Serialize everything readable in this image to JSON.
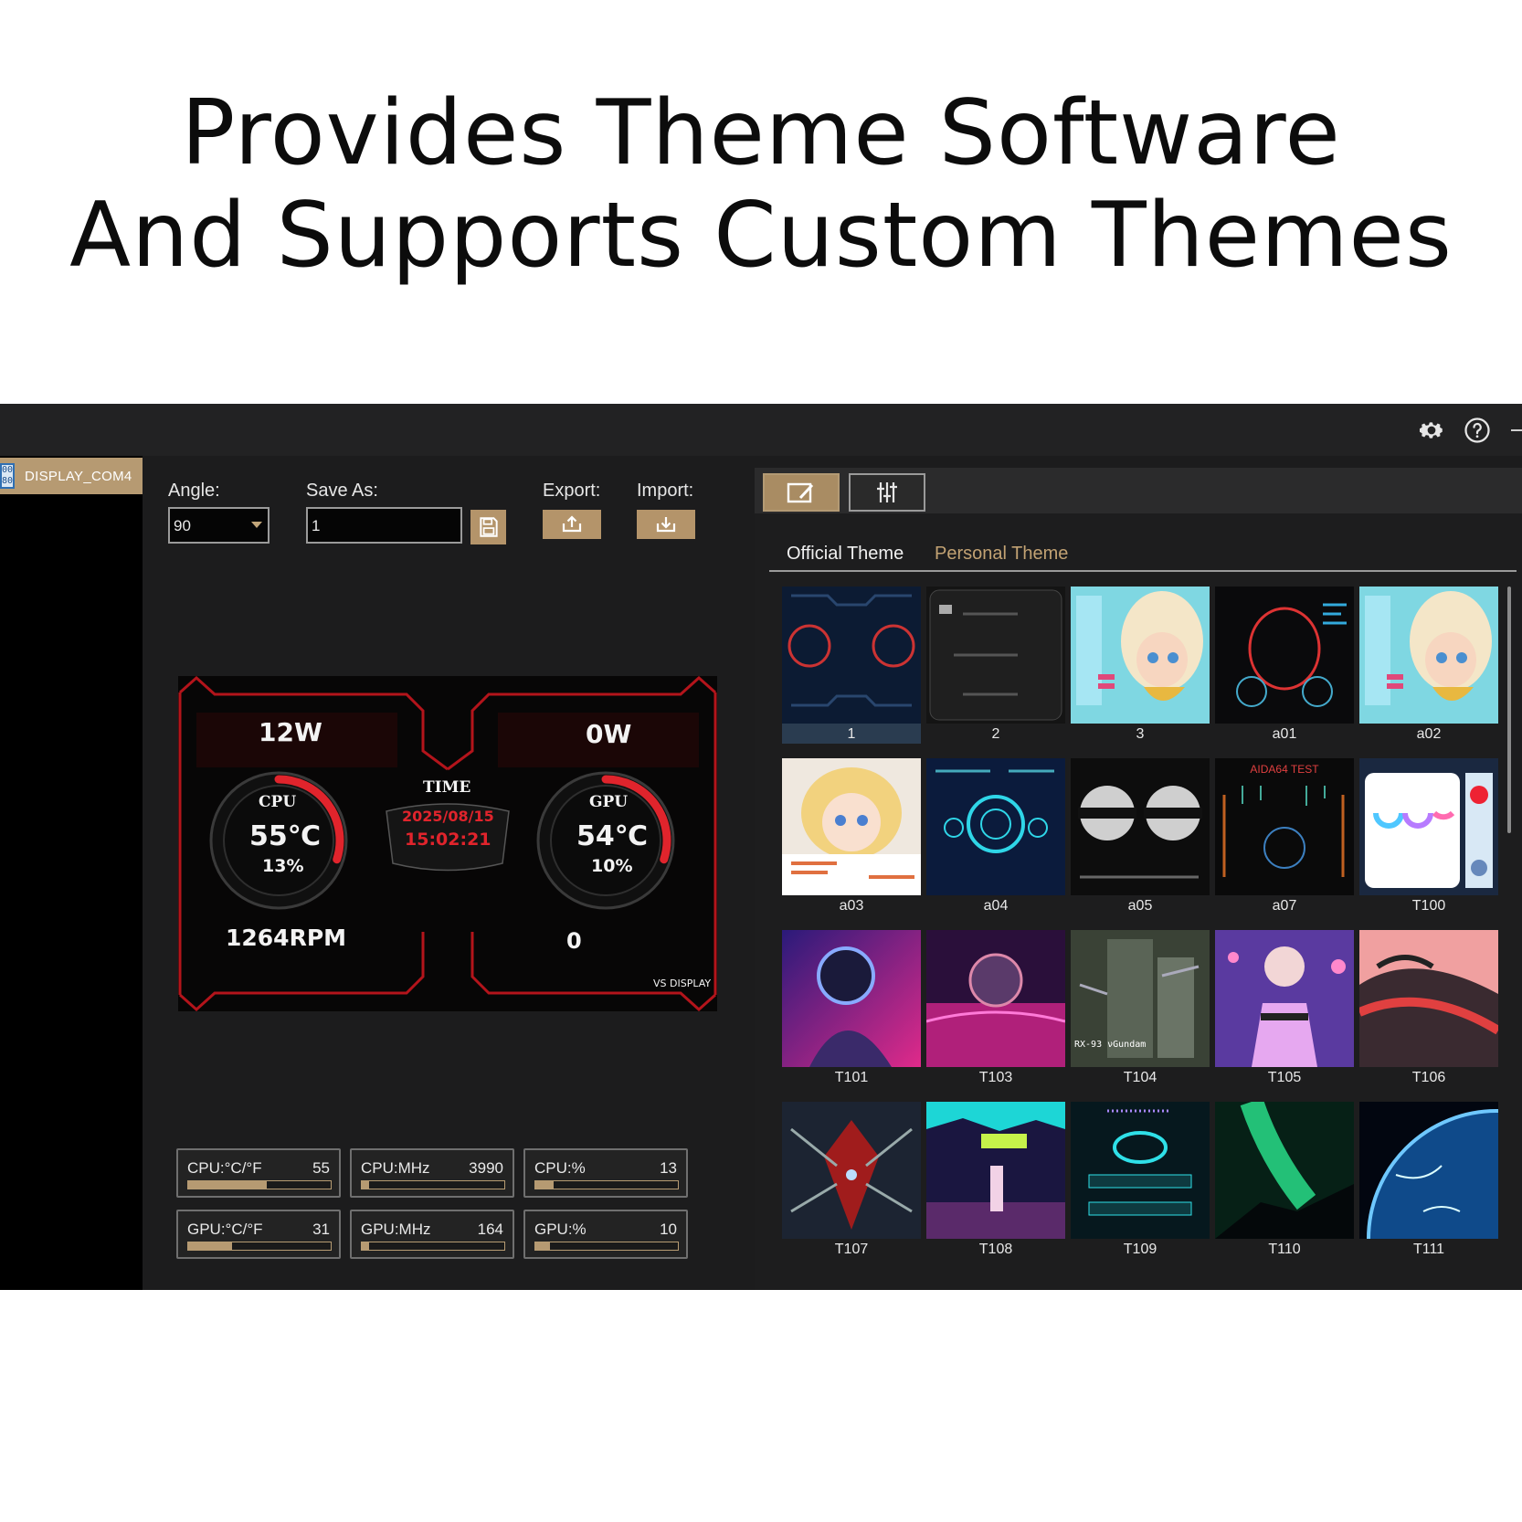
{
  "headline": {
    "line1": "Provides Theme Software",
    "line2": "And Supports Custom Themes"
  },
  "titlebar": {
    "icons": [
      "gear-icon",
      "help-icon",
      "minimize-icon"
    ]
  },
  "sidebar": {
    "device": {
      "label": "DISPLAY_COM4",
      "icon_text": "00 80"
    }
  },
  "toolbar": {
    "angle_label": "Angle:",
    "angle_value": "90",
    "save_as_label": "Save As:",
    "save_as_value": "1",
    "export_label": "Export:",
    "import_label": "Import:"
  },
  "preview": {
    "cpu_power": "12W",
    "gpu_power": "0W",
    "cpu_label": "CPU",
    "cpu_temp": "55℃",
    "cpu_load": "13%",
    "gpu_label": "GPU",
    "gpu_temp": "54℃",
    "gpu_load": "10%",
    "time_label": "TIME",
    "date": "2025/08/15",
    "time": "15:02:21",
    "fan_rpm": "1264RPM",
    "gpu_fan": "0",
    "brand": "VS DISPLAY",
    "cpu_gauge_fraction": 0.3,
    "gpu_gauge_fraction": 0.3,
    "accent_color": "#e0242c"
  },
  "sensors": [
    {
      "name": "CPU:°C/°F",
      "value": "55",
      "fill": 0.55
    },
    {
      "name": "CPU:MHz",
      "value": "3990",
      "fill": 0.05
    },
    {
      "name": "CPU:%",
      "value": "13",
      "fill": 0.13
    },
    {
      "name": "GPU:°C/°F",
      "value": "31",
      "fill": 0.31
    },
    {
      "name": "GPU:MHz",
      "value": "164",
      "fill": 0.05
    },
    {
      "name": "GPU:%",
      "value": "10",
      "fill": 0.1
    }
  ],
  "theme_panel": {
    "tabs": [
      "edit-theme-icon",
      "settings-sliders-icon"
    ],
    "official_tab": "Official Theme",
    "personal_tab": "Personal Theme",
    "accent_color": "#c2a273",
    "themes": [
      {
        "label": "1",
        "style": "dark-gauges",
        "selected": true
      },
      {
        "label": "2",
        "style": "dark-panel"
      },
      {
        "label": "3",
        "style": "anime-cyan"
      },
      {
        "label": "a01",
        "style": "hud-red"
      },
      {
        "label": "a02",
        "style": "anime-cyan"
      },
      {
        "label": "a03",
        "style": "anime-blonde"
      },
      {
        "label": "a04",
        "style": "hud-blue"
      },
      {
        "label": "a05",
        "style": "bw-gauges"
      },
      {
        "label": "a07",
        "style": "aida64",
        "image_text": "AIDA64 TEST"
      },
      {
        "label": "T100",
        "style": "rainbow-ring"
      },
      {
        "label": "T101",
        "style": "astronaut"
      },
      {
        "label": "T103",
        "style": "astronaut-pink"
      },
      {
        "label": "T104",
        "style": "gundam",
        "image_text": "RX-93 νGundam"
      },
      {
        "label": "T105",
        "style": "anime-purple"
      },
      {
        "label": "T106",
        "style": "red-clouds"
      },
      {
        "label": "T107",
        "style": "ironman"
      },
      {
        "label": "T108",
        "style": "neon-city"
      },
      {
        "label": "T109",
        "style": "cyber-circle"
      },
      {
        "label": "T110",
        "style": "aurora"
      },
      {
        "label": "T111",
        "style": "earth"
      }
    ]
  }
}
